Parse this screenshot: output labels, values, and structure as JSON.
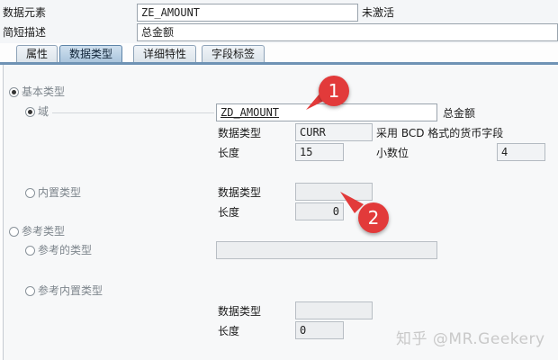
{
  "header": {
    "data_element_label": "数据元素",
    "data_element_value": "ZE_AMOUNT",
    "status": "未激活",
    "short_desc_label": "简短描述",
    "short_desc_value": "总金额"
  },
  "tabs": [
    {
      "label": "属性",
      "active": false
    },
    {
      "label": "数据类型",
      "active": true
    },
    {
      "label": "详细特性",
      "active": false
    },
    {
      "label": "字段标签",
      "active": false
    }
  ],
  "basic_type": {
    "label": "基本类型",
    "selected": true,
    "domain": {
      "label": "域",
      "selected": true,
      "value": "ZD_AMOUNT",
      "desc": "总金额",
      "data_type_label": "数据类型",
      "data_type_value": "CURR",
      "data_type_desc": "采用 BCD 格式的货币字段",
      "length_label": "长度",
      "length_value": "15",
      "decimals_label": "小数位",
      "decimals_value": "4"
    },
    "builtin": {
      "label": "内置类型",
      "selected": false,
      "data_type_label": "数据类型",
      "data_type_value": "",
      "length_label": "长度",
      "length_value": "0"
    }
  },
  "reference_type": {
    "label": "参考类型",
    "selected": false,
    "ref_type": {
      "label": "参考的类型",
      "value": ""
    },
    "ref_builtin": {
      "label": "参考内置类型",
      "data_type_label": "数据类型",
      "data_type_value": "",
      "length_label": "长度",
      "length_value": "0"
    }
  },
  "callouts": {
    "one": "1",
    "two": "2"
  },
  "watermark": "知乎 @MR.Geekery",
  "colors": {
    "callout": "#e23a3a",
    "active_tab": "#a9c4dc",
    "tab_border": "#6f93b5"
  }
}
